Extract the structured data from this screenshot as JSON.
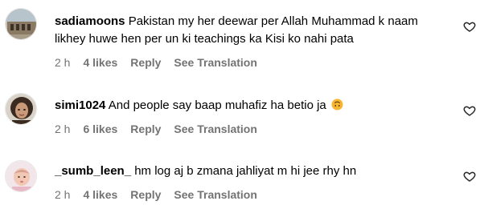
{
  "comments": [
    {
      "username": "sadiamoons",
      "text": "Pakistan my her deewar per Allah Muhammad k naam likhey huwe hen per un ki teachings ka Kisi ko nahi pata",
      "time": "2 h",
      "likes": "4 likes",
      "reply": "Reply",
      "translate": "See Translation",
      "avatar_icon": "profile-photo-building",
      "liked": false
    },
    {
      "username": "simi1024",
      "text": "And people say baap muhafiz ha betio ja",
      "emoji": "upside-down-face-emoji",
      "time": "2 h",
      "likes": "6 likes",
      "reply": "Reply",
      "translate": "See Translation",
      "avatar_icon": "profile-photo-woman",
      "liked": false
    },
    {
      "username": "_sumb_leen_",
      "text": "hm log aj b zmana jahliyat m hi jee rhy hn",
      "time": "2 h",
      "likes": "4 likes",
      "reply": "Reply",
      "translate": "See Translation",
      "avatar_icon": "profile-photo-baby",
      "liked": false
    }
  ],
  "colors": {
    "text": "#000000",
    "meta": "#737373",
    "heart_outline": "#262626"
  }
}
